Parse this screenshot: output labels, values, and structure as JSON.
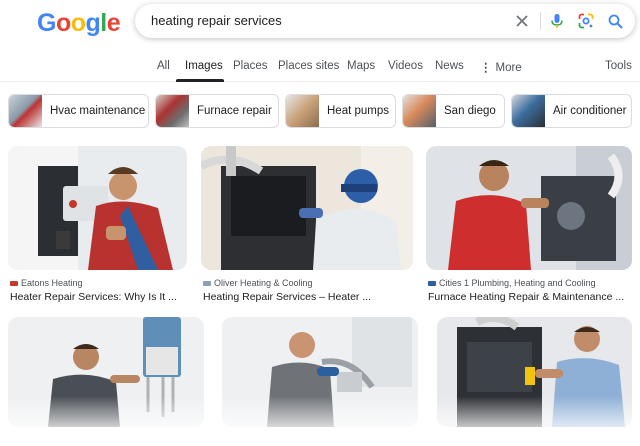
{
  "header": {
    "logo_letters": [
      "G",
      "o",
      "o",
      "g",
      "l",
      "e"
    ],
    "query": "heating repair services"
  },
  "tabs": [
    {
      "label": "All"
    },
    {
      "label": "Images"
    },
    {
      "label": "Places"
    },
    {
      "label": "Places sites"
    },
    {
      "label": "Maps"
    },
    {
      "label": "Videos"
    },
    {
      "label": "News"
    },
    {
      "label": "More"
    },
    {
      "label": "Tools"
    }
  ],
  "chips": [
    {
      "label": "Hvac maintenance"
    },
    {
      "label": "Furnace repair"
    },
    {
      "label": "Heat pumps"
    },
    {
      "label": "San diego"
    },
    {
      "label": "Air conditioner"
    }
  ],
  "results": [
    {
      "source": "Eatons Heating",
      "title": "Heater Repair Services: Why Is It ..."
    },
    {
      "source": "Oliver Heating & Cooling",
      "title": "Heating Repair Services – Heater ..."
    },
    {
      "source": "Cities 1 Plumbing, Heating and Cooling",
      "title": "Furnace Heating Repair & Maintenance ..."
    },
    {
      "source": "",
      "title": ""
    },
    {
      "source": "",
      "title": ""
    },
    {
      "source": "",
      "title": ""
    }
  ],
  "colors": {
    "blue": "#4285f4",
    "red": "#ea4335",
    "yellow": "#fbbc05",
    "green": "#34a853"
  },
  "icons": {
    "clear": "close-icon",
    "voice": "microphone-icon",
    "lens": "lens-icon",
    "search": "search-icon",
    "more": "more-vert-icon"
  }
}
